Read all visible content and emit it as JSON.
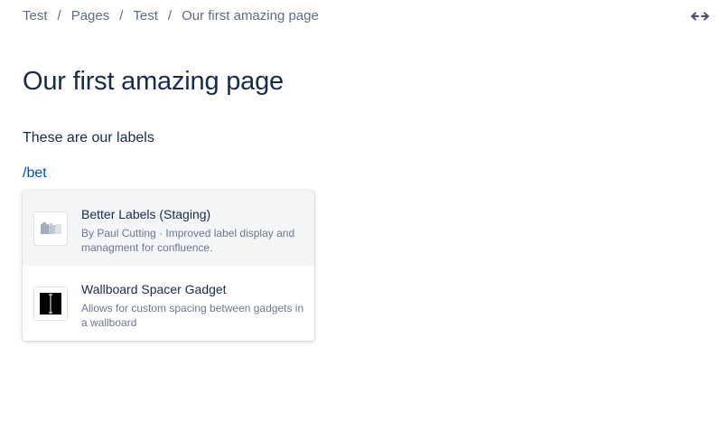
{
  "breadcrumb": {
    "items": [
      "Test",
      "Pages",
      "Test",
      "Our first amazing page"
    ],
    "separator": "/"
  },
  "header": {
    "expand_icon": "double-arrow-icon"
  },
  "page": {
    "title": "Our first amazing page",
    "paragraph": "These are our labels",
    "slash_command": "/bet"
  },
  "dropdown": {
    "items": [
      {
        "title": "Better Labels (Staging)",
        "description": "By Paul Cutting · Improved label display and managment for confluence.",
        "icon": "labels-app-icon",
        "selected": true
      },
      {
        "title": "Wallboard Spacer Gadget",
        "description": "Allows for custom spacing between gadgets in a wallboard",
        "icon": "spacer-gadget-icon",
        "selected": false
      }
    ]
  },
  "colors": {
    "text": "#172b4d",
    "muted": "#5e6c84",
    "link": "#0052cc",
    "selected_bg": "#f4f5f7"
  }
}
